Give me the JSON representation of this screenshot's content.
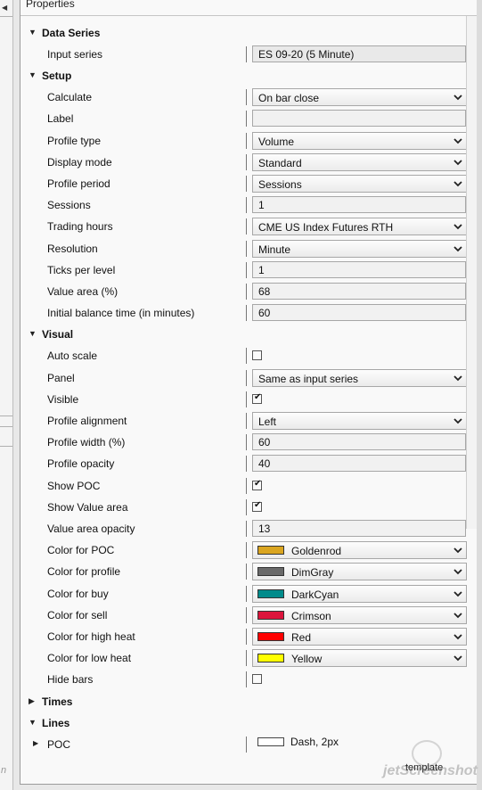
{
  "panel_title": "Properties",
  "footer": {
    "template_label": "template",
    "watermark": "jetScreenshot"
  },
  "left_strip_fragment": "n",
  "colors": {
    "Goldenrod": "#daa520",
    "DimGray": "#696969",
    "DarkCyan": "#008b8b",
    "Crimson": "#dc143c",
    "Red": "#ff0000",
    "Yellow": "#ffff00",
    "White": "#ffffff"
  },
  "sections": [
    {
      "name": "Data Series",
      "expanded": true,
      "props": [
        {
          "label": "Input series",
          "kind": "readonly",
          "value": "ES 09-20 (5 Minute)"
        }
      ]
    },
    {
      "name": "Setup",
      "expanded": true,
      "props": [
        {
          "label": "Calculate",
          "kind": "select",
          "value": "On bar close"
        },
        {
          "label": "Label",
          "kind": "text",
          "value": ""
        },
        {
          "label": "Profile type",
          "kind": "select",
          "value": "Volume"
        },
        {
          "label": "Display mode",
          "kind": "select",
          "value": "Standard"
        },
        {
          "label": "Profile period",
          "kind": "select",
          "value": "Sessions"
        },
        {
          "label": "Sessions",
          "kind": "text",
          "value": "1"
        },
        {
          "label": "Trading hours",
          "kind": "select",
          "value": "CME US Index Futures RTH"
        },
        {
          "label": "Resolution",
          "kind": "select",
          "value": "Minute"
        },
        {
          "label": "Ticks per level",
          "kind": "text",
          "value": "1"
        },
        {
          "label": "Value area (%)",
          "kind": "text",
          "value": "68"
        },
        {
          "label": "Initial balance time (in minutes)",
          "kind": "text",
          "value": "60"
        }
      ]
    },
    {
      "name": "Visual",
      "expanded": true,
      "props": [
        {
          "label": "Auto scale",
          "kind": "checkbox",
          "checked": false
        },
        {
          "label": "Panel",
          "kind": "select",
          "value": "Same as input series"
        },
        {
          "label": "Visible",
          "kind": "checkbox",
          "checked": true
        },
        {
          "label": "Profile alignment",
          "kind": "select",
          "value": "Left"
        },
        {
          "label": "Profile width (%)",
          "kind": "text",
          "value": "60"
        },
        {
          "label": "Profile opacity",
          "kind": "text",
          "value": "40"
        },
        {
          "label": "Show POC",
          "kind": "checkbox",
          "checked": true
        },
        {
          "label": "Show Value area",
          "kind": "checkbox",
          "checked": true
        },
        {
          "label": "Value area opacity",
          "kind": "text",
          "value": "13"
        },
        {
          "label": "Color for POC",
          "kind": "color",
          "value": "Goldenrod"
        },
        {
          "label": "Color for profile",
          "kind": "color",
          "value": "DimGray"
        },
        {
          "label": "Color for buy",
          "kind": "color",
          "value": "DarkCyan"
        },
        {
          "label": "Color for sell",
          "kind": "color",
          "value": "Crimson"
        },
        {
          "label": "Color for high heat",
          "kind": "color",
          "value": "Red"
        },
        {
          "label": "Color for low heat",
          "kind": "color",
          "value": "Yellow"
        },
        {
          "label": "Hide bars",
          "kind": "checkbox",
          "checked": false
        }
      ]
    },
    {
      "name": "Times",
      "expanded": false,
      "props": []
    },
    {
      "name": "Lines",
      "expanded": true,
      "props": [
        {
          "label": "POC",
          "kind": "stroke",
          "value": "Dash, 2px",
          "expandable": true,
          "swatch": "White"
        }
      ]
    }
  ]
}
